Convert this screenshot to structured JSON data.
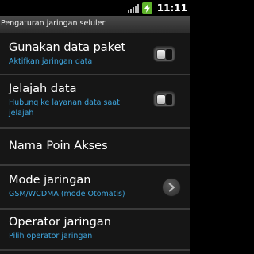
{
  "status_bar": {
    "time": "11:11",
    "signal_icon": "signal-bars-icon",
    "battery_icon": "battery-charging-icon",
    "battery_color": "#5fb42c"
  },
  "title_bar": {
    "title": "Pengaturan jaringan seluler"
  },
  "colors": {
    "subtitle": "#3fa7e0",
    "divider": "#3a3a3a",
    "background": "#161616"
  },
  "settings": [
    {
      "title": "Gunakan data paket",
      "subtitle": "Aktifkan jaringan data",
      "control": "toggle",
      "checked": false
    },
    {
      "title": "Jelajah data",
      "subtitle": "Hubung ke layanan data saat jelajah",
      "control": "toggle",
      "checked": false
    },
    {
      "title": "Nama Poin Akses",
      "subtitle": "",
      "control": "none"
    },
    {
      "title": "Mode jaringan",
      "subtitle": "GSM/WCDMA (mode Otomatis)",
      "control": "chevron"
    },
    {
      "title": "Operator jaringan",
      "subtitle": "Pilih operator jaringan",
      "control": "none"
    }
  ]
}
